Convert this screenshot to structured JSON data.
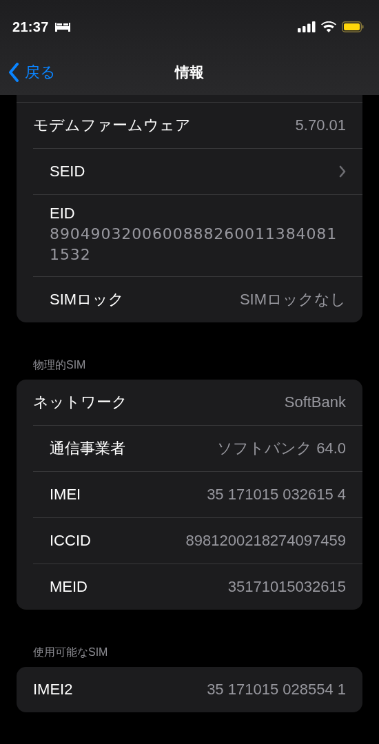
{
  "status_bar": {
    "time": "21:37"
  },
  "nav": {
    "back": "戻る",
    "title": "情報"
  },
  "sections": [
    {
      "kind": "cut_top",
      "rows": [
        {
          "kind": "value",
          "label": "モデムファームウェア",
          "value": "5.70.01"
        },
        {
          "kind": "chevron",
          "label": "SEID"
        },
        {
          "kind": "stacked",
          "label": "EID",
          "value": "89049032006008882600113840811532"
        },
        {
          "kind": "value",
          "label": "SIMロック",
          "value": "SIMロックなし"
        }
      ]
    },
    {
      "kind": "full",
      "header": "物理的SIM",
      "rows": [
        {
          "kind": "value",
          "label": "ネットワーク",
          "value": "SoftBank"
        },
        {
          "kind": "value",
          "label": "通信事業者",
          "value": "ソフトバンク 64.0"
        },
        {
          "kind": "value",
          "label": "IMEI",
          "value": "35 171015 032615 4"
        },
        {
          "kind": "value",
          "label": "ICCID",
          "value": "8981200218274097459"
        },
        {
          "kind": "value",
          "label": "MEID",
          "value": "35171015032615"
        }
      ]
    },
    {
      "kind": "full",
      "header": "使用可能なSIM",
      "rows": [
        {
          "kind": "value",
          "label": "IMEI2",
          "value": "35 171015 028554 1"
        }
      ]
    },
    {
      "kind": "cut_bottom"
    }
  ]
}
